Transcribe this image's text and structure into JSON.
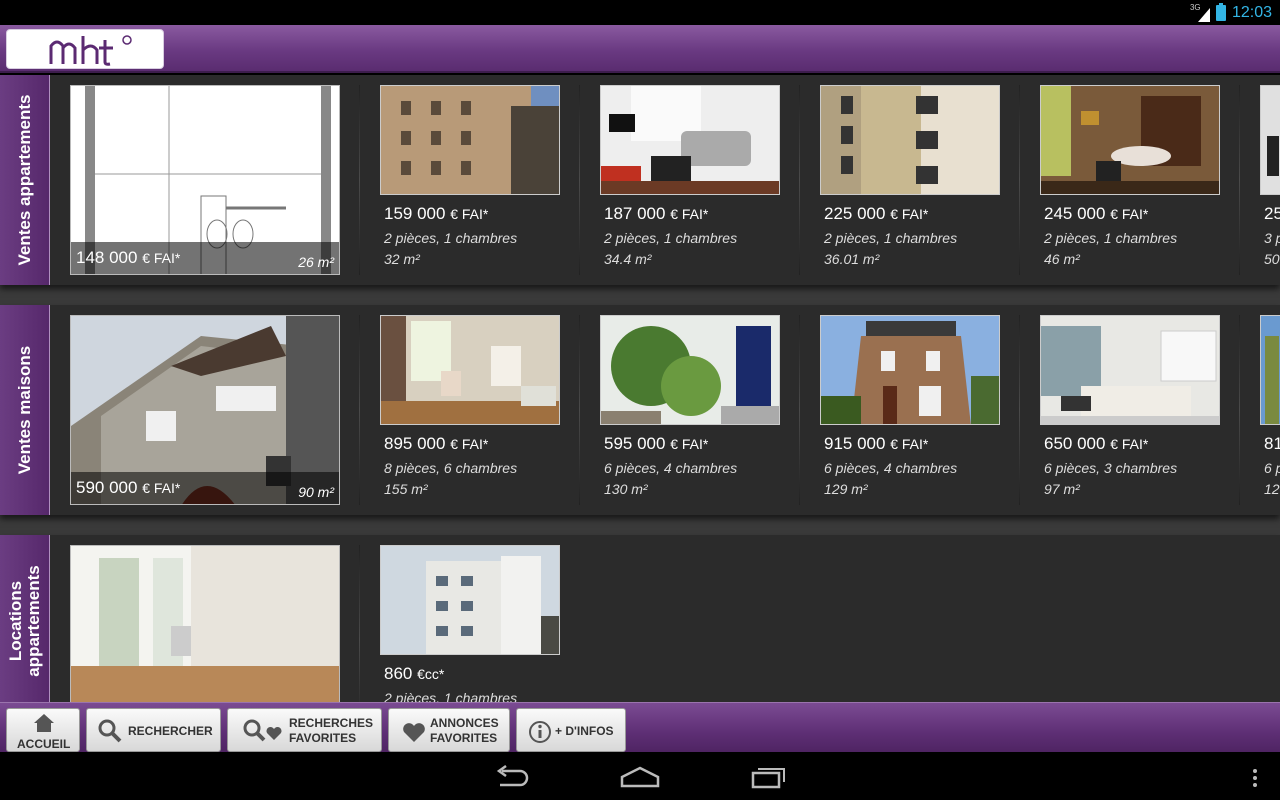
{
  "status_bar": {
    "network": "3G",
    "time": "12:03"
  },
  "header": {
    "logo_text": "mh"
  },
  "sections": [
    {
      "title": "Ventes appartements",
      "featured": {
        "price": "148 000",
        "unit": "€ FAI*",
        "area": "26 m²"
      },
      "listings": [
        {
          "price": "159 000",
          "unit": "€ FAI*",
          "rooms": "2 pièces, 1 chambres",
          "surface": "32 m²"
        },
        {
          "price": "187 000",
          "unit": "€ FAI*",
          "rooms": "2 pièces, 1 chambres",
          "surface": "34.4 m²"
        },
        {
          "price": "225 000",
          "unit": "€ FAI*",
          "rooms": "2 pièces, 1 chambres",
          "surface": "36.01 m²"
        },
        {
          "price": "245 000",
          "unit": "€ FAI*",
          "rooms": "2 pièces, 1 chambres",
          "surface": "46 m²"
        },
        {
          "price": "25",
          "unit": "",
          "rooms": "3 p",
          "surface": "50"
        }
      ]
    },
    {
      "title": "Ventes maisons",
      "featured": {
        "price": "590 000",
        "unit": "€ FAI*",
        "area": "90 m²"
      },
      "listings": [
        {
          "price": "895 000",
          "unit": "€ FAI*",
          "rooms": "8 pièces, 6 chambres",
          "surface": "155 m²"
        },
        {
          "price": "595 000",
          "unit": "€ FAI*",
          "rooms": "6 pièces, 4 chambres",
          "surface": "130 m²"
        },
        {
          "price": "915 000",
          "unit": "€ FAI*",
          "rooms": "6 pièces, 4 chambres",
          "surface": "129 m²"
        },
        {
          "price": "650 000",
          "unit": "€ FAI*",
          "rooms": "6 pièces, 3 chambres",
          "surface": "97 m²"
        },
        {
          "price": "81",
          "unit": "",
          "rooms": "6 p",
          "surface": "12"
        }
      ]
    },
    {
      "title": "Locations\nappartements",
      "listings": [
        {
          "price": "860",
          "unit": "€cc*",
          "rooms": "2 pièces, 1 chambres"
        }
      ]
    }
  ],
  "bottom_nav": {
    "home": "ACCUEIL",
    "search": "RECHERCHER",
    "fav_search_1": "RECHERCHES",
    "fav_search_2": "FAVORITES",
    "fav_ads_1": "ANNONCES",
    "fav_ads_2": "FAVORITES",
    "info": "+ D'INFOS"
  },
  "colors": {
    "brand_purple": "#6a3a82",
    "status_blue": "#33b5e5"
  }
}
